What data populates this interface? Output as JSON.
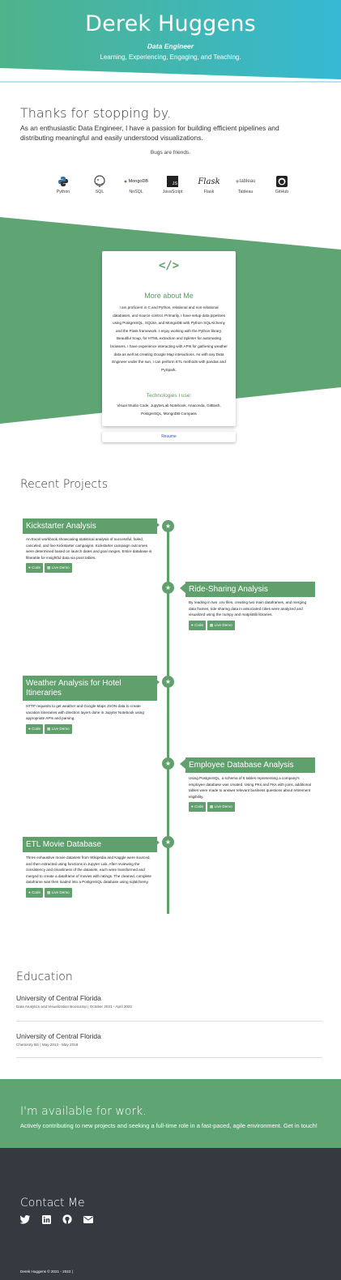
{
  "header": {
    "name": "Derek Huggens",
    "role": "Data Engineer",
    "tagline": "Learning, Experiencing, Engaging, and Teaching."
  },
  "intro": {
    "title": "Thanks for stopping by.",
    "text": "As an enthusiastic Data Engineer, I have a passion for building efficient pipelines and distributing meaningful and easily understood visualizations.",
    "bugs": "Bugs are friends."
  },
  "skills": [
    {
      "label": "Python",
      "icon": "python-icon"
    },
    {
      "label": "SQL",
      "icon": "postgresql-icon"
    },
    {
      "label": "NoSQL",
      "icon": "mongodb-icon",
      "logo_text": "MongoDB"
    },
    {
      "label": "JavaScript",
      "icon": "javascript-icon",
      "logo_text": "JS"
    },
    {
      "label": "Flask",
      "icon": "flask-icon",
      "logo_text": "Flask"
    },
    {
      "label": "Tableau",
      "icon": "tableau-icon",
      "logo_text": "tableau"
    },
    {
      "label": "GitHub",
      "icon": "github-icon"
    }
  ],
  "about": {
    "heading": "More about Me",
    "text": "I am proficient in C and Python, relational and non-relational databases, and source control. Primarily, I have setup data pipelines using PostgreSQL, SQLite, and MongoDB with Python SQLAlchemy and the Flask framework. I enjoy working with the Python library, Beautiful Soup, for HTML extraction and Splinter for automating browsers. I have experience interacting with APIs for gathering weather data as well as creating Google Map interactions. As with any Data Engineer under the sun, I can perform ETL methods with pandas and PySpark.",
    "tech_heading": "Technologies I use:",
    "tech_text": "Visual Studio Code, JupyterLab Notebook, Anaconda, GitBash, PostgreSQL, MongoDB Compass",
    "resume_label": "Resume"
  },
  "projects_heading": "Recent Projects",
  "projects": [
    {
      "title": "Kickstarter Analysis",
      "desc": "An Excel workbook showcasing statistical analysis of successful, failed, canceled, and live Kickstarter campaigns. Kickstarter campaign outcomes were determined based on launch dates and goal ranges. Entire database is filterable for insightful data via pivot tables.",
      "code": "Code",
      "demo": "Live Demo"
    },
    {
      "title": "Ride-Sharing Analysis",
      "desc": "By reading in two .csv files, creating two main dataframes, and merging data frames, ride sharing data in associated cities were analyzed and visualized using the numpy and matplotlib libraries.",
      "code": "Code",
      "demo": "Live Demo"
    },
    {
      "title": "Weather Analysis for Hotel Itineraries",
      "desc": "HTTP requests to get weather and Google Maps JSON data to create vacation itineraries with direction layers done in Jupyter Notebook using appropriate APIs and parsing.",
      "code": "Code",
      "demo": "Live Demo"
    },
    {
      "title": "Employee Database Analysis",
      "desc": "Using PostgreSQL, a schema of 6 tables representing a company's employee database was created. Using PKs and FKs with joins, additional tables were made to answer relevant business questions about retirement eligibility.",
      "code": "Code",
      "demo": "Live Demo"
    },
    {
      "title": "ETL Movie Database",
      "desc": "Three exhaustive movie datasets from Wikipedia and Kaggle were sourced, and then extracted using functions in Jupyter Lab. After reviewing the consistency and cleanliness of the datasets, each were transformed and merged to create a dataframe of movies with ratings. The cleaned, complete dataframe was then loaded into a PostgreSQL database using sqlalchemy.",
      "code": "Code",
      "demo": "Live Demo"
    }
  ],
  "education_heading": "Education",
  "education": [
    {
      "school": "University of Central Florida",
      "detail": "Data Analytics and Visualization Bootcamp | October 2021 - April 2022"
    },
    {
      "school": "University of Central Florida",
      "detail": "Chemistry BS | May 2013 - May 2018"
    }
  ],
  "available": {
    "heading": "I'm available for work.",
    "text": "Actively contributing to new projects and seeking a full-time role in a fast-paced, agile environment. Get in touch!"
  },
  "footer": {
    "heading": "Contact Me",
    "icons": [
      "twitter-icon",
      "linkedin-icon",
      "github-icon",
      "email-icon"
    ],
    "copyright": "Derek Huggens © 2021 - 2022 |"
  },
  "colors": {
    "accent_green": "#5fa06c",
    "header_gradient_start": "#4fb38a",
    "header_gradient_end": "#35b9d4",
    "footer_dark": "#343a40"
  }
}
